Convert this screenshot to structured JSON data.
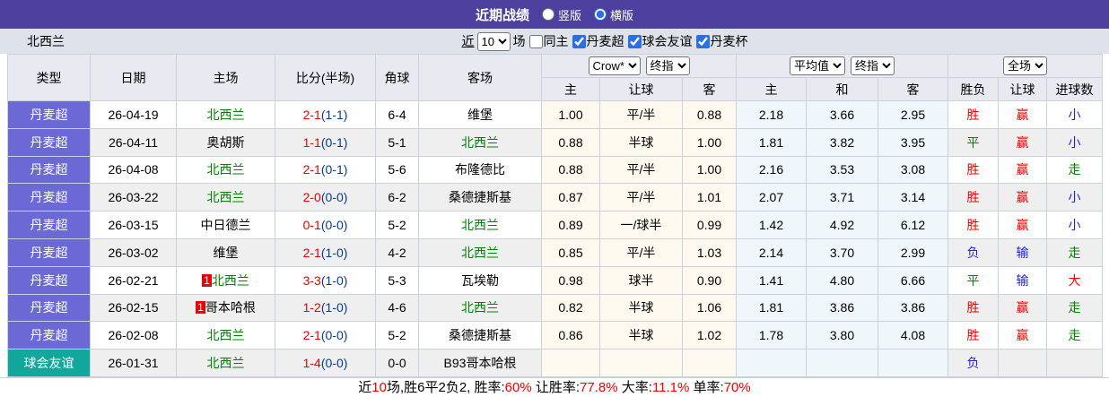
{
  "colors": {
    "titlebar_bg": "#4d3f9e",
    "filterbar_bg": "#dde2eb",
    "header_bg": "#e9eaf1",
    "league_super_bg": "#6b69d6",
    "league_friendly_bg": "#12a79d",
    "team_highlight_green": "#008000",
    "score_red": "#e80000",
    "half_score_navy": "#0b3b8c",
    "result_blue": "#2222dd",
    "ah_column_bg": "#fdf9ee",
    "eu_column_bg": "#eff7fb",
    "stripe_bg": "#efefef",
    "checkbox_accent": "#2b6fe8"
  },
  "title_bar": {
    "title": "近期战绩",
    "layout_options": [
      {
        "label": "竖版",
        "selected": false
      },
      {
        "label": "横版",
        "selected": true
      }
    ]
  },
  "filter_bar": {
    "team": "北西兰",
    "near_label": "近",
    "count_value": "10",
    "games_label": "场",
    "same_home": {
      "label": "同主",
      "checked": false
    },
    "leagues": [
      {
        "label": "丹麦超",
        "checked": true
      },
      {
        "label": "球会友谊",
        "checked": true
      },
      {
        "label": "丹麦杯",
        "checked": true
      }
    ]
  },
  "table": {
    "static_headers": [
      "类型",
      "日期",
      "主场",
      "比分(半场)",
      "角球",
      "客场"
    ],
    "selects": {
      "bookmaker": "Crow*",
      "bookmaker_index": "终指",
      "average": "平均值",
      "average_index": "终指",
      "scope": "全场"
    },
    "sub_headers": [
      "主",
      "让球",
      "客",
      "主",
      "和",
      "客",
      "胜负",
      "让球",
      "进球数"
    ],
    "rows": [
      {
        "league": "丹麦超",
        "league_variant": "super",
        "date": "26-04-19",
        "home_rank": "",
        "home": "北西兰",
        "home_color": "green",
        "score": "2-1",
        "half": "(1-1)",
        "corner": "6-4",
        "away": "维堡",
        "away_color": "black",
        "ah_home": "1.00",
        "ah_line": "平/半",
        "ah_away": "0.88",
        "eu_home": "2.18",
        "eu_draw": "3.66",
        "eu_away": "2.95",
        "res_wdl": "胜",
        "res_wdl_color": "red",
        "res_ah": "赢",
        "res_ah_color": "red",
        "res_ou": "小",
        "res_ou_color": "blue"
      },
      {
        "league": "丹麦超",
        "league_variant": "super",
        "date": "26-04-11",
        "home_rank": "",
        "home": "奥胡斯",
        "home_color": "black",
        "score": "1-1",
        "half": "(0-1)",
        "corner": "5-1",
        "away": "北西兰",
        "away_color": "green",
        "ah_home": "0.88",
        "ah_line": "半球",
        "ah_away": "1.00",
        "eu_home": "1.81",
        "eu_draw": "3.82",
        "eu_away": "3.95",
        "res_wdl": "平",
        "res_wdl_color": "green",
        "res_ah": "赢",
        "res_ah_color": "red",
        "res_ou": "小",
        "res_ou_color": "blue"
      },
      {
        "league": "丹麦超",
        "league_variant": "super",
        "date": "26-04-08",
        "home_rank": "",
        "home": "北西兰",
        "home_color": "green",
        "score": "2-1",
        "half": "(0-1)",
        "corner": "5-6",
        "away": "布隆德比",
        "away_color": "black",
        "ah_home": "0.88",
        "ah_line": "平/半",
        "ah_away": "1.00",
        "eu_home": "2.16",
        "eu_draw": "3.53",
        "eu_away": "3.08",
        "res_wdl": "胜",
        "res_wdl_color": "red",
        "res_ah": "赢",
        "res_ah_color": "red",
        "res_ou": "走",
        "res_ou_color": "green"
      },
      {
        "league": "丹麦超",
        "league_variant": "super",
        "date": "26-03-22",
        "home_rank": "",
        "home": "北西兰",
        "home_color": "green",
        "score": "2-0",
        "half": "(0-0)",
        "corner": "6-2",
        "away": "桑德捷斯基",
        "away_color": "black",
        "ah_home": "0.87",
        "ah_line": "平/半",
        "ah_away": "1.01",
        "eu_home": "2.07",
        "eu_draw": "3.71",
        "eu_away": "3.14",
        "res_wdl": "胜",
        "res_wdl_color": "red",
        "res_ah": "赢",
        "res_ah_color": "red",
        "res_ou": "小",
        "res_ou_color": "blue"
      },
      {
        "league": "丹麦超",
        "league_variant": "super",
        "date": "26-03-15",
        "home_rank": "",
        "home": "中日德兰",
        "home_color": "black",
        "score": "0-1",
        "half": "(0-0)",
        "corner": "5-2",
        "away": "北西兰",
        "away_color": "green",
        "ah_home": "0.89",
        "ah_line": "一/球半",
        "ah_away": "0.99",
        "eu_home": "1.42",
        "eu_draw": "4.92",
        "eu_away": "6.12",
        "res_wdl": "胜",
        "res_wdl_color": "red",
        "res_ah": "赢",
        "res_ah_color": "red",
        "res_ou": "小",
        "res_ou_color": "blue"
      },
      {
        "league": "丹麦超",
        "league_variant": "super",
        "date": "26-03-02",
        "home_rank": "",
        "home": "维堡",
        "home_color": "black",
        "score": "2-1",
        "half": "(1-0)",
        "corner": "4-2",
        "away": "北西兰",
        "away_color": "green",
        "ah_home": "0.85",
        "ah_line": "平/半",
        "ah_away": "1.03",
        "eu_home": "2.14",
        "eu_draw": "3.70",
        "eu_away": "2.99",
        "res_wdl": "负",
        "res_wdl_color": "blue",
        "res_ah": "输",
        "res_ah_color": "blue",
        "res_ou": "走",
        "res_ou_color": "green"
      },
      {
        "league": "丹麦超",
        "league_variant": "super",
        "date": "26-02-21",
        "home_rank": "1",
        "home": "北西兰",
        "home_color": "green",
        "score": "3-3",
        "half": "(1-0)",
        "corner": "5-3",
        "away": "瓦埃勒",
        "away_color": "black",
        "ah_home": "0.98",
        "ah_line": "球半",
        "ah_away": "0.90",
        "eu_home": "1.41",
        "eu_draw": "4.80",
        "eu_away": "6.66",
        "res_wdl": "平",
        "res_wdl_color": "green",
        "res_ah": "输",
        "res_ah_color": "blue",
        "res_ou": "大",
        "res_ou_color": "red"
      },
      {
        "league": "丹麦超",
        "league_variant": "super",
        "date": "26-02-15",
        "home_rank": "1",
        "home": "哥本哈根",
        "home_color": "black",
        "score": "1-2",
        "half": "(1-0)",
        "corner": "4-6",
        "away": "北西兰",
        "away_color": "green",
        "ah_home": "0.82",
        "ah_line": "半球",
        "ah_away": "1.06",
        "eu_home": "1.81",
        "eu_draw": "3.86",
        "eu_away": "3.86",
        "res_wdl": "胜",
        "res_wdl_color": "red",
        "res_ah": "赢",
        "res_ah_color": "red",
        "res_ou": "走",
        "res_ou_color": "green"
      },
      {
        "league": "丹麦超",
        "league_variant": "super",
        "date": "26-02-08",
        "home_rank": "",
        "home": "北西兰",
        "home_color": "green",
        "score": "2-1",
        "half": "(0-0)",
        "corner": "5-2",
        "away": "桑德捷斯基",
        "away_color": "black",
        "ah_home": "0.86",
        "ah_line": "半球",
        "ah_away": "1.02",
        "eu_home": "1.78",
        "eu_draw": "3.80",
        "eu_away": "4.08",
        "res_wdl": "胜",
        "res_wdl_color": "red",
        "res_ah": "赢",
        "res_ah_color": "red",
        "res_ou": "走",
        "res_ou_color": "green"
      },
      {
        "league": "球会友谊",
        "league_variant": "friendly",
        "date": "26-01-31",
        "home_rank": "",
        "home": "北西兰",
        "home_color": "green",
        "score": "1-4",
        "half": "(0-0)",
        "corner": "0-0",
        "away": "B93哥本哈根",
        "away_color": "black",
        "ah_home": "",
        "ah_line": "",
        "ah_away": "",
        "eu_home": "",
        "eu_draw": "",
        "eu_away": "",
        "res_wdl": "负",
        "res_wdl_color": "blue",
        "res_ah": "",
        "res_ah_color": "",
        "res_ou": "",
        "res_ou_color": ""
      }
    ]
  },
  "footer": {
    "parts": [
      {
        "t": "近",
        "c": "black"
      },
      {
        "t": "10",
        "c": "red"
      },
      {
        "t": "场,胜6平2负2, 胜率:",
        "c": "black"
      },
      {
        "t": "60%",
        "c": "red"
      },
      {
        "t": " 让胜率:",
        "c": "black"
      },
      {
        "t": "77.8%",
        "c": "red"
      },
      {
        "t": " 大率:",
        "c": "black"
      },
      {
        "t": "11.1%",
        "c": "red"
      },
      {
        "t": " 单率:",
        "c": "black"
      },
      {
        "t": "70%",
        "c": "red"
      }
    ]
  }
}
